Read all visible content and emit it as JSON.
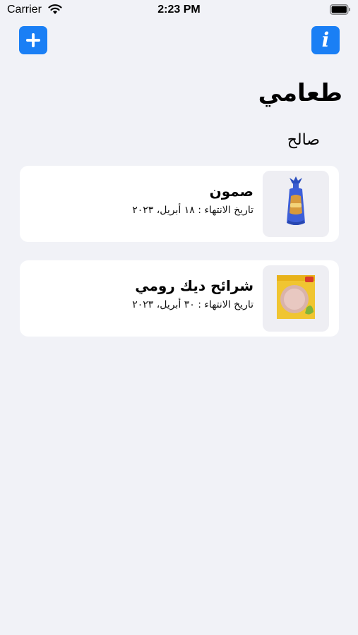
{
  "status_bar": {
    "carrier": "Carrier",
    "time": "2:23 PM"
  },
  "nav": {
    "add_icon": "plus-icon",
    "info_icon": "info-icon",
    "info_glyph": "i",
    "accent_color": "#1a7ff5"
  },
  "page": {
    "title": "طعامي",
    "section_title": "صالح"
  },
  "items": [
    {
      "name": "صمون",
      "expiry": "تاريخ الانتهاء : ١٨ أبريل، ٢٠٢٣",
      "image": "bread-bag-image"
    },
    {
      "name": "شرائح ديك رومي",
      "expiry": "تاريخ الانتهاء : ٣٠ أبريل، ٢٠٢٣",
      "image": "turkey-slices-package-image"
    }
  ]
}
